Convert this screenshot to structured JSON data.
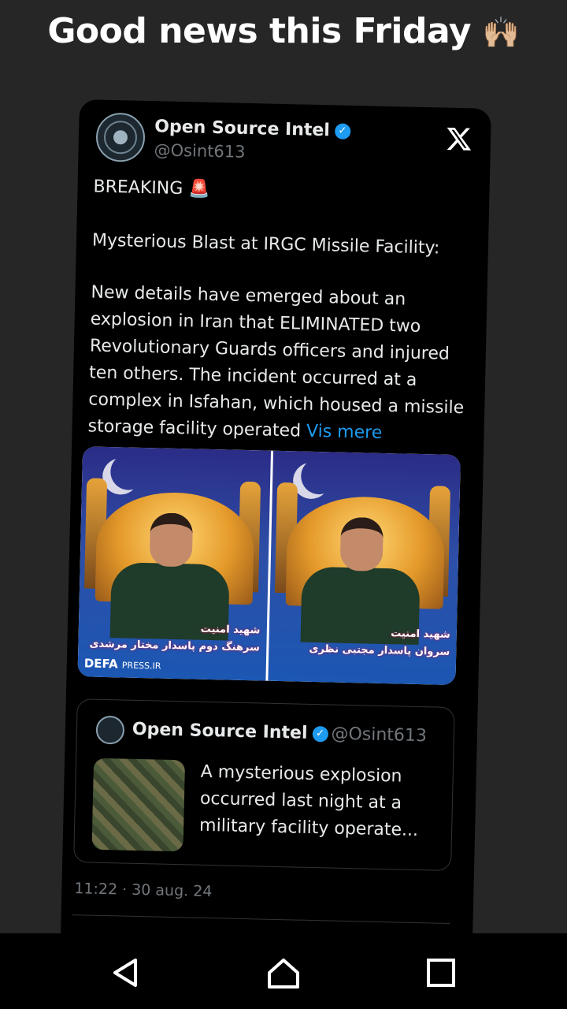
{
  "caption": {
    "text": "Good news this Friday",
    "emoji": "🙌🏼"
  },
  "tweet": {
    "author_name": "Open Source Intel",
    "author_handle": "@Osint613",
    "verified_glyph": "✓",
    "platform_logo": "x-logo-icon",
    "line1": "BREAKING 🚨",
    "line2": "Mysterious Blast at IRGC Missile Facility:",
    "body": "New details have emerged about an explosion in Iran that ELIMINATED two Revolutionary Guards officers and injured ten others. The incident occurred at a complex in Isfahan, which housed a missile storage facility operated",
    "show_more": "Vis mere",
    "image_left_caption_1": "شهید امنیت",
    "image_left_caption_2": "سرهنگ دوم پاسدار مختار مرشدی",
    "image_left_source_brand": "DEFA",
    "image_left_source_domain": "PRESS.IR",
    "image_right_caption_1": "شهید امنیت",
    "image_right_caption_2": "سروان پاسدار مجتبی نظری",
    "timestamp": "11:22 · 30 aug. 24"
  },
  "quoted_tweet": {
    "author_name": "Open Source Intel",
    "author_handle": "@Osint613",
    "text": "A mysterious explosion occurred last night at a military facility operate..."
  },
  "navbar": {
    "icons": [
      "back-icon",
      "home-icon",
      "recent-apps-icon"
    ]
  },
  "colors": {
    "accent": "#1d9bf0",
    "card_bg": "#000000",
    "page_bg": "#262626",
    "muted": "#71767b"
  }
}
